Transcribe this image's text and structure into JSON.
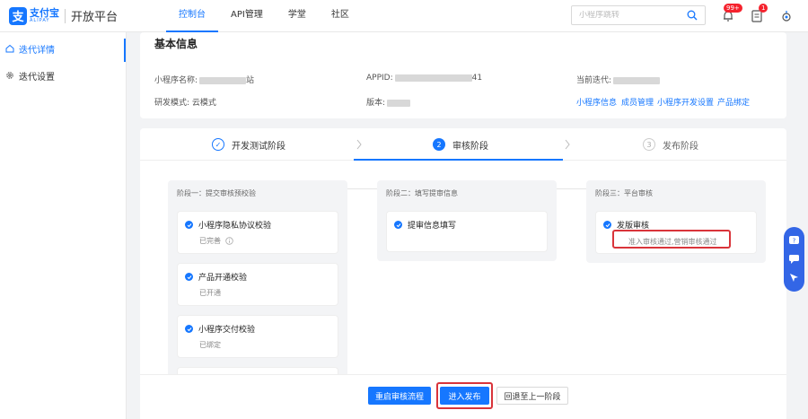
{
  "brand": {
    "logo_cn": "支付宝",
    "logo_en": "ALIPAY",
    "platform": "开放平台",
    "accent": "#1677ff"
  },
  "nav": [
    {
      "label": "控制台"
    },
    {
      "label": "API管理"
    },
    {
      "label": "学堂"
    },
    {
      "label": "社区"
    }
  ],
  "search": {
    "placeholder": "小程序跳转"
  },
  "notifications": {
    "bell_badge": "99+",
    "todo_badge": "1"
  },
  "sidebar": {
    "items": [
      {
        "label": "迭代详情"
      },
      {
        "label": "迭代设置"
      }
    ]
  },
  "basic_info": {
    "title": "基本信息",
    "name_label": "小程序名称:",
    "name_suffix": "站",
    "appid_label": "APPID:",
    "appid_suffix": "41",
    "iteration_label": "当前迭代:",
    "dev_mode_label": "研发模式:",
    "dev_mode_value": "云模式",
    "version_label": "版本:",
    "links": [
      "小程序信息",
      "成员管理",
      "小程序开发设置",
      "产品绑定"
    ]
  },
  "stepper": {
    "steps": [
      {
        "num": "✓",
        "label": "开发测试阶段"
      },
      {
        "num": "2",
        "label": "审核阶段"
      },
      {
        "num": "3",
        "label": "发布阶段"
      }
    ]
  },
  "stages": {
    "col1": {
      "title": "阶段一：提交审核预校验",
      "items": [
        {
          "title": "小程序隐私协议校验",
          "sub": "已完善"
        },
        {
          "title": "产品开通校验",
          "sub": "已开通"
        },
        {
          "title": "小程序交付校验",
          "sub": "已绑定"
        }
      ]
    },
    "col2": {
      "title": "阶段二：填写提审信息",
      "items": [
        {
          "title": "提审信息填写"
        }
      ]
    },
    "col3": {
      "title": "阶段三：平台审核",
      "items": [
        {
          "title": "发版审核",
          "sub": "准入审核通过,营销审核通过"
        }
      ]
    }
  },
  "actions": {
    "restart": "重启审核流程",
    "publish": "进入发布",
    "back": "回退至上一阶段"
  }
}
